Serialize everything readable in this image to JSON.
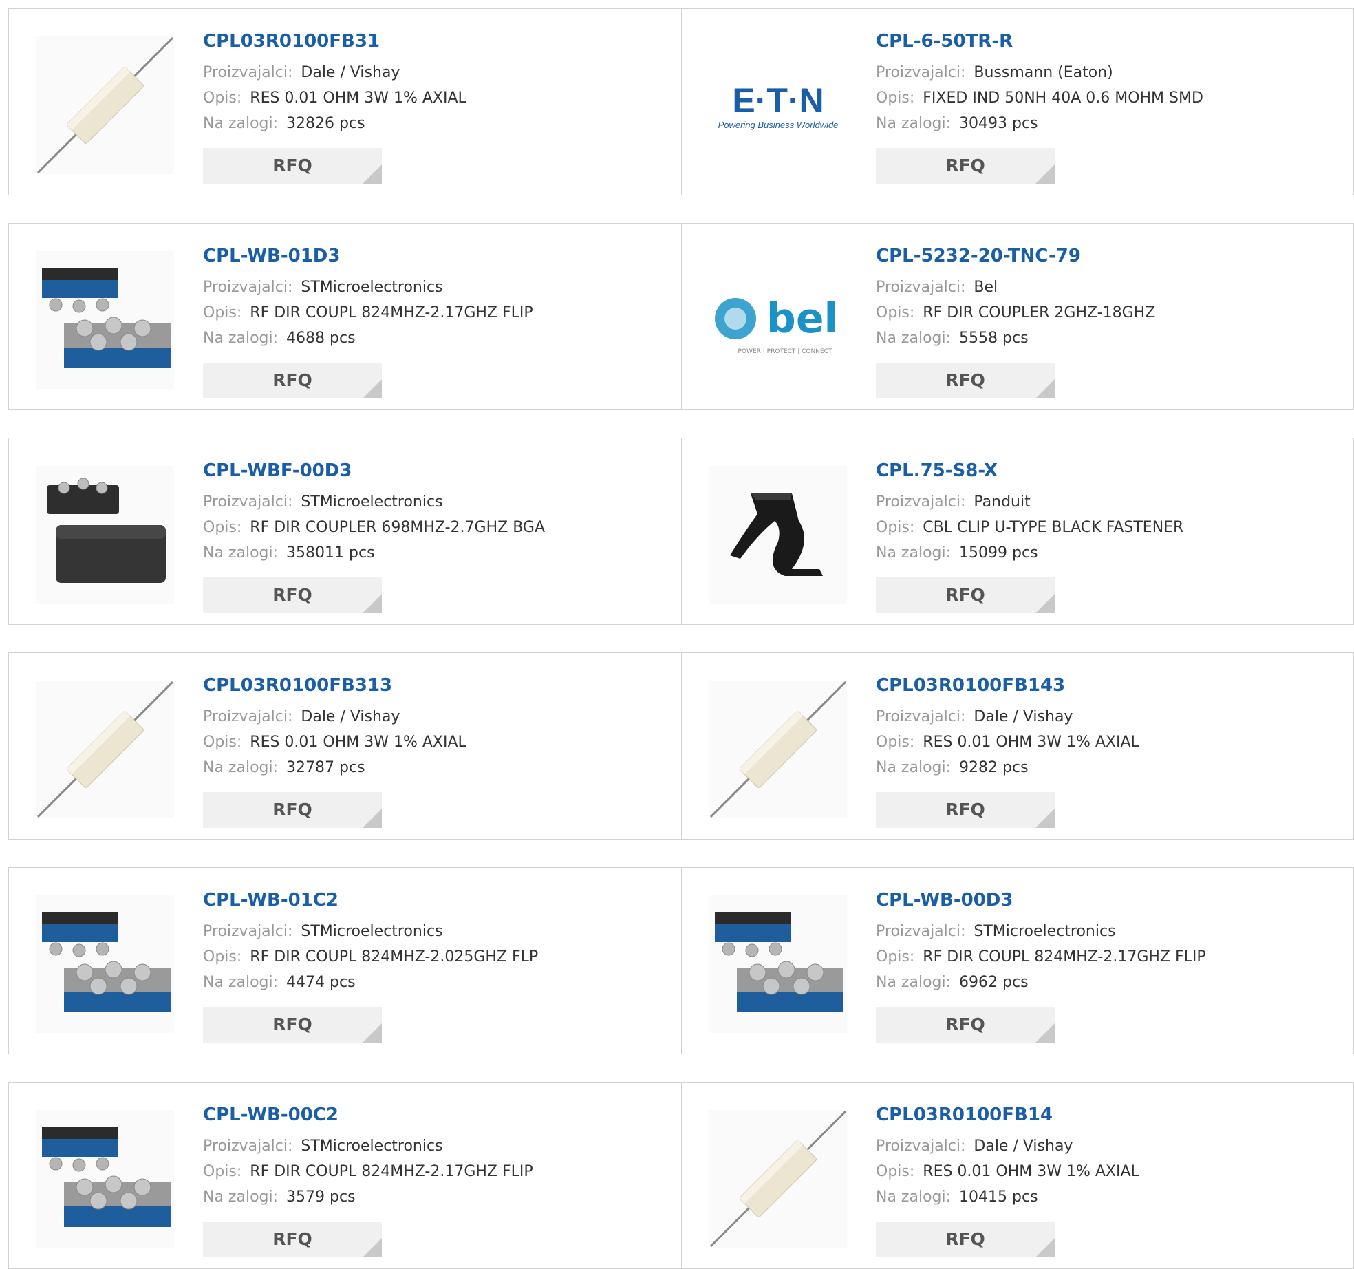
{
  "labels": {
    "manufacturer": "Proizvajalci:",
    "description": "Opis:",
    "stock": "Na zalogi:",
    "rfq": "RFQ"
  },
  "colors": {
    "part_link": "#1a5ea8",
    "label": "#999999",
    "value": "#333333",
    "button_bg": "#f0f0f0"
  },
  "products": [
    {
      "part": "CPL03R0100FB31",
      "manufacturer": "Dale / Vishay",
      "description": "RES 0.01 OHM 3W 1% AXIAL",
      "stock": "32826 pcs",
      "image": "axial-resistor"
    },
    {
      "part": "CPL-6-50TR-R",
      "manufacturer": "Bussmann (Eaton)",
      "description": "FIXED IND 50NH 40A 0.6 MOHM SMD",
      "stock": "30493 pcs",
      "image": "eaton-logo",
      "logo_text": "E·T·N",
      "logo_tagline": "Powering Business Worldwide"
    },
    {
      "part": "CPL-WB-01D3",
      "manufacturer": "STMicroelectronics",
      "description": "RF DIR COUPL 824MHZ-2.17GHZ FLIP",
      "stock": "4688 pcs",
      "image": "flip-chip"
    },
    {
      "part": "CPL-5232-20-TNC-79",
      "manufacturer": "Bel",
      "description": "RF DIR COUPLER 2GHZ-18GHZ",
      "stock": "5558 pcs",
      "image": "bel-logo",
      "logo_text": "bel",
      "logo_tagline": "POWER | PROTECT | CONNECT"
    },
    {
      "part": "CPL-WBF-00D3",
      "manufacturer": "STMicroelectronics",
      "description": "RF DIR COUPLER 698MHZ-2.7GHZ BGA",
      "stock": "358011 pcs",
      "image": "bga-chip"
    },
    {
      "part": "CPL.75-S8-X",
      "manufacturer": "Panduit",
      "description": "CBL CLIP U-TYPE BLACK FASTENER",
      "stock": "15099 pcs",
      "image": "cable-clip"
    },
    {
      "part": "CPL03R0100FB313",
      "manufacturer": "Dale / Vishay",
      "description": "RES 0.01 OHM 3W 1% AXIAL",
      "stock": "32787 pcs",
      "image": "axial-resistor"
    },
    {
      "part": "CPL03R0100FB143",
      "manufacturer": "Dale / Vishay",
      "description": "RES 0.01 OHM 3W 1% AXIAL",
      "stock": "9282 pcs",
      "image": "axial-resistor"
    },
    {
      "part": "CPL-WB-01C2",
      "manufacturer": "STMicroelectronics",
      "description": "RF DIR COUPL 824MHZ-2.025GHZ FLP",
      "stock": "4474 pcs",
      "image": "flip-chip"
    },
    {
      "part": "CPL-WB-00D3",
      "manufacturer": "STMicroelectronics",
      "description": "RF DIR COUPL 824MHZ-2.17GHZ FLIP",
      "stock": "6962 pcs",
      "image": "flip-chip"
    },
    {
      "part": "CPL-WB-00C2",
      "manufacturer": "STMicroelectronics",
      "description": "RF DIR COUPL 824MHZ-2.17GHZ FLIP",
      "stock": "3579 pcs",
      "image": "flip-chip"
    },
    {
      "part": "CPL03R0100FB14",
      "manufacturer": "Dale / Vishay",
      "description": "RES 0.01 OHM 3W 1% AXIAL",
      "stock": "10415 pcs",
      "image": "axial-resistor"
    }
  ]
}
